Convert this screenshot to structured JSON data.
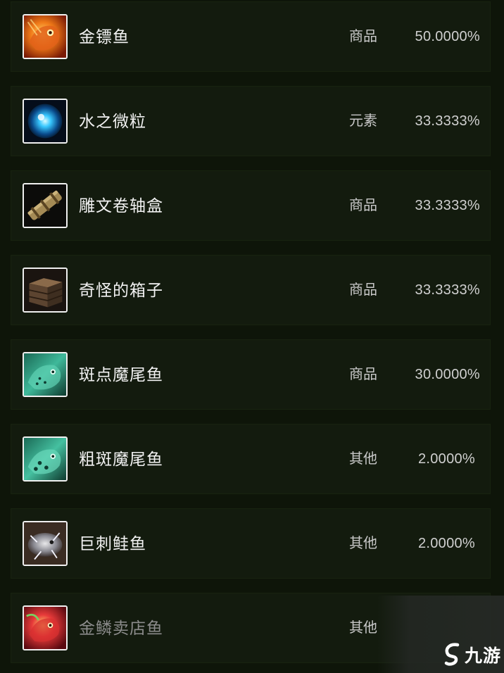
{
  "items": [
    {
      "name": "金镖鱼",
      "type": "商品",
      "chance": "50.0000%",
      "icon": "golden-fish-icon"
    },
    {
      "name": "水之微粒",
      "type": "元素",
      "chance": "33.3333%",
      "icon": "water-mote-icon"
    },
    {
      "name": "雕文卷轴盒",
      "type": "商品",
      "chance": "33.3333%",
      "icon": "scroll-case-icon"
    },
    {
      "name": "奇怪的箱子",
      "type": "商品",
      "chance": "33.3333%",
      "icon": "wooden-crate-icon"
    },
    {
      "name": "斑点魔尾鱼",
      "type": "商品",
      "chance": "30.0000%",
      "icon": "spotted-fish-icon"
    },
    {
      "name": "粗斑魔尾鱼",
      "type": "其他",
      "chance": "2.0000%",
      "icon": "coarse-spotted-fish-icon"
    },
    {
      "name": "巨刺鲑鱼",
      "type": "其他",
      "chance": "2.0000%",
      "icon": "spiny-salmon-icon"
    },
    {
      "name": "金鳞卖店鱼",
      "type": "其他",
      "chance": "",
      "icon": "red-fish-icon"
    }
  ],
  "watermark": {
    "text": "九游"
  },
  "colors": {
    "background": "#0e1509",
    "row": "#131b0e",
    "text": "#f2f2f2"
  }
}
